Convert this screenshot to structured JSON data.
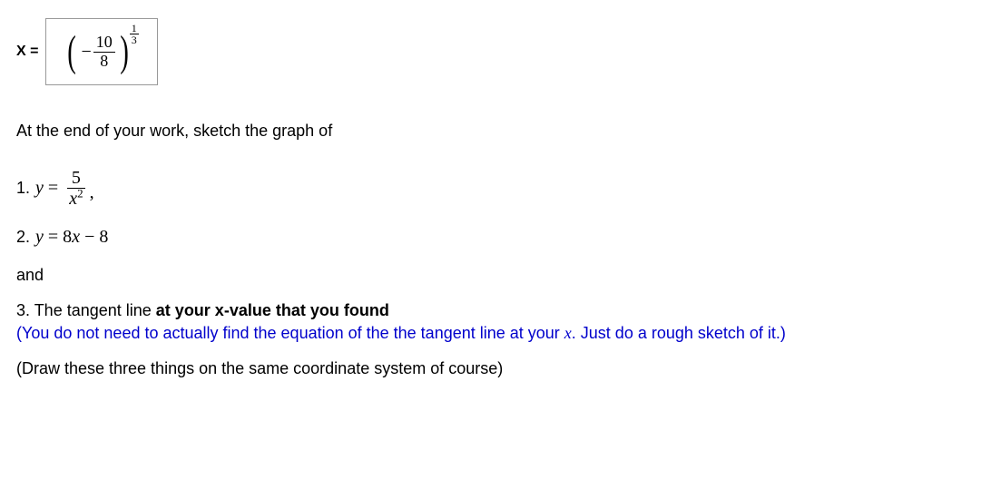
{
  "xLabel": "X =",
  "box": {
    "minus": "−",
    "innerNum": "10",
    "innerDen": "8",
    "expNum": "1",
    "expDen": "3"
  },
  "instruction": "At the end of your work, sketch the graph of",
  "eq1": {
    "prefix": "1. ",
    "yEquals": "y",
    "equals": " = ",
    "num": "5",
    "denVar": "x",
    "denExp": "2",
    "comma": ","
  },
  "eq2": {
    "prefix": "2. ",
    "expr": "y = 8x − 8"
  },
  "and": "and",
  "item3": {
    "prefix": "3. The tangent line ",
    "bold": "at your x-value that you found"
  },
  "blueNote": {
    "part1": "(You do not need to actually find the equation of the the tangent line at your ",
    "xvar": "x",
    "part2": ". Just do a rough sketch of it.)"
  },
  "finalNote": "(Draw these three things on the same coordinate system of course)"
}
